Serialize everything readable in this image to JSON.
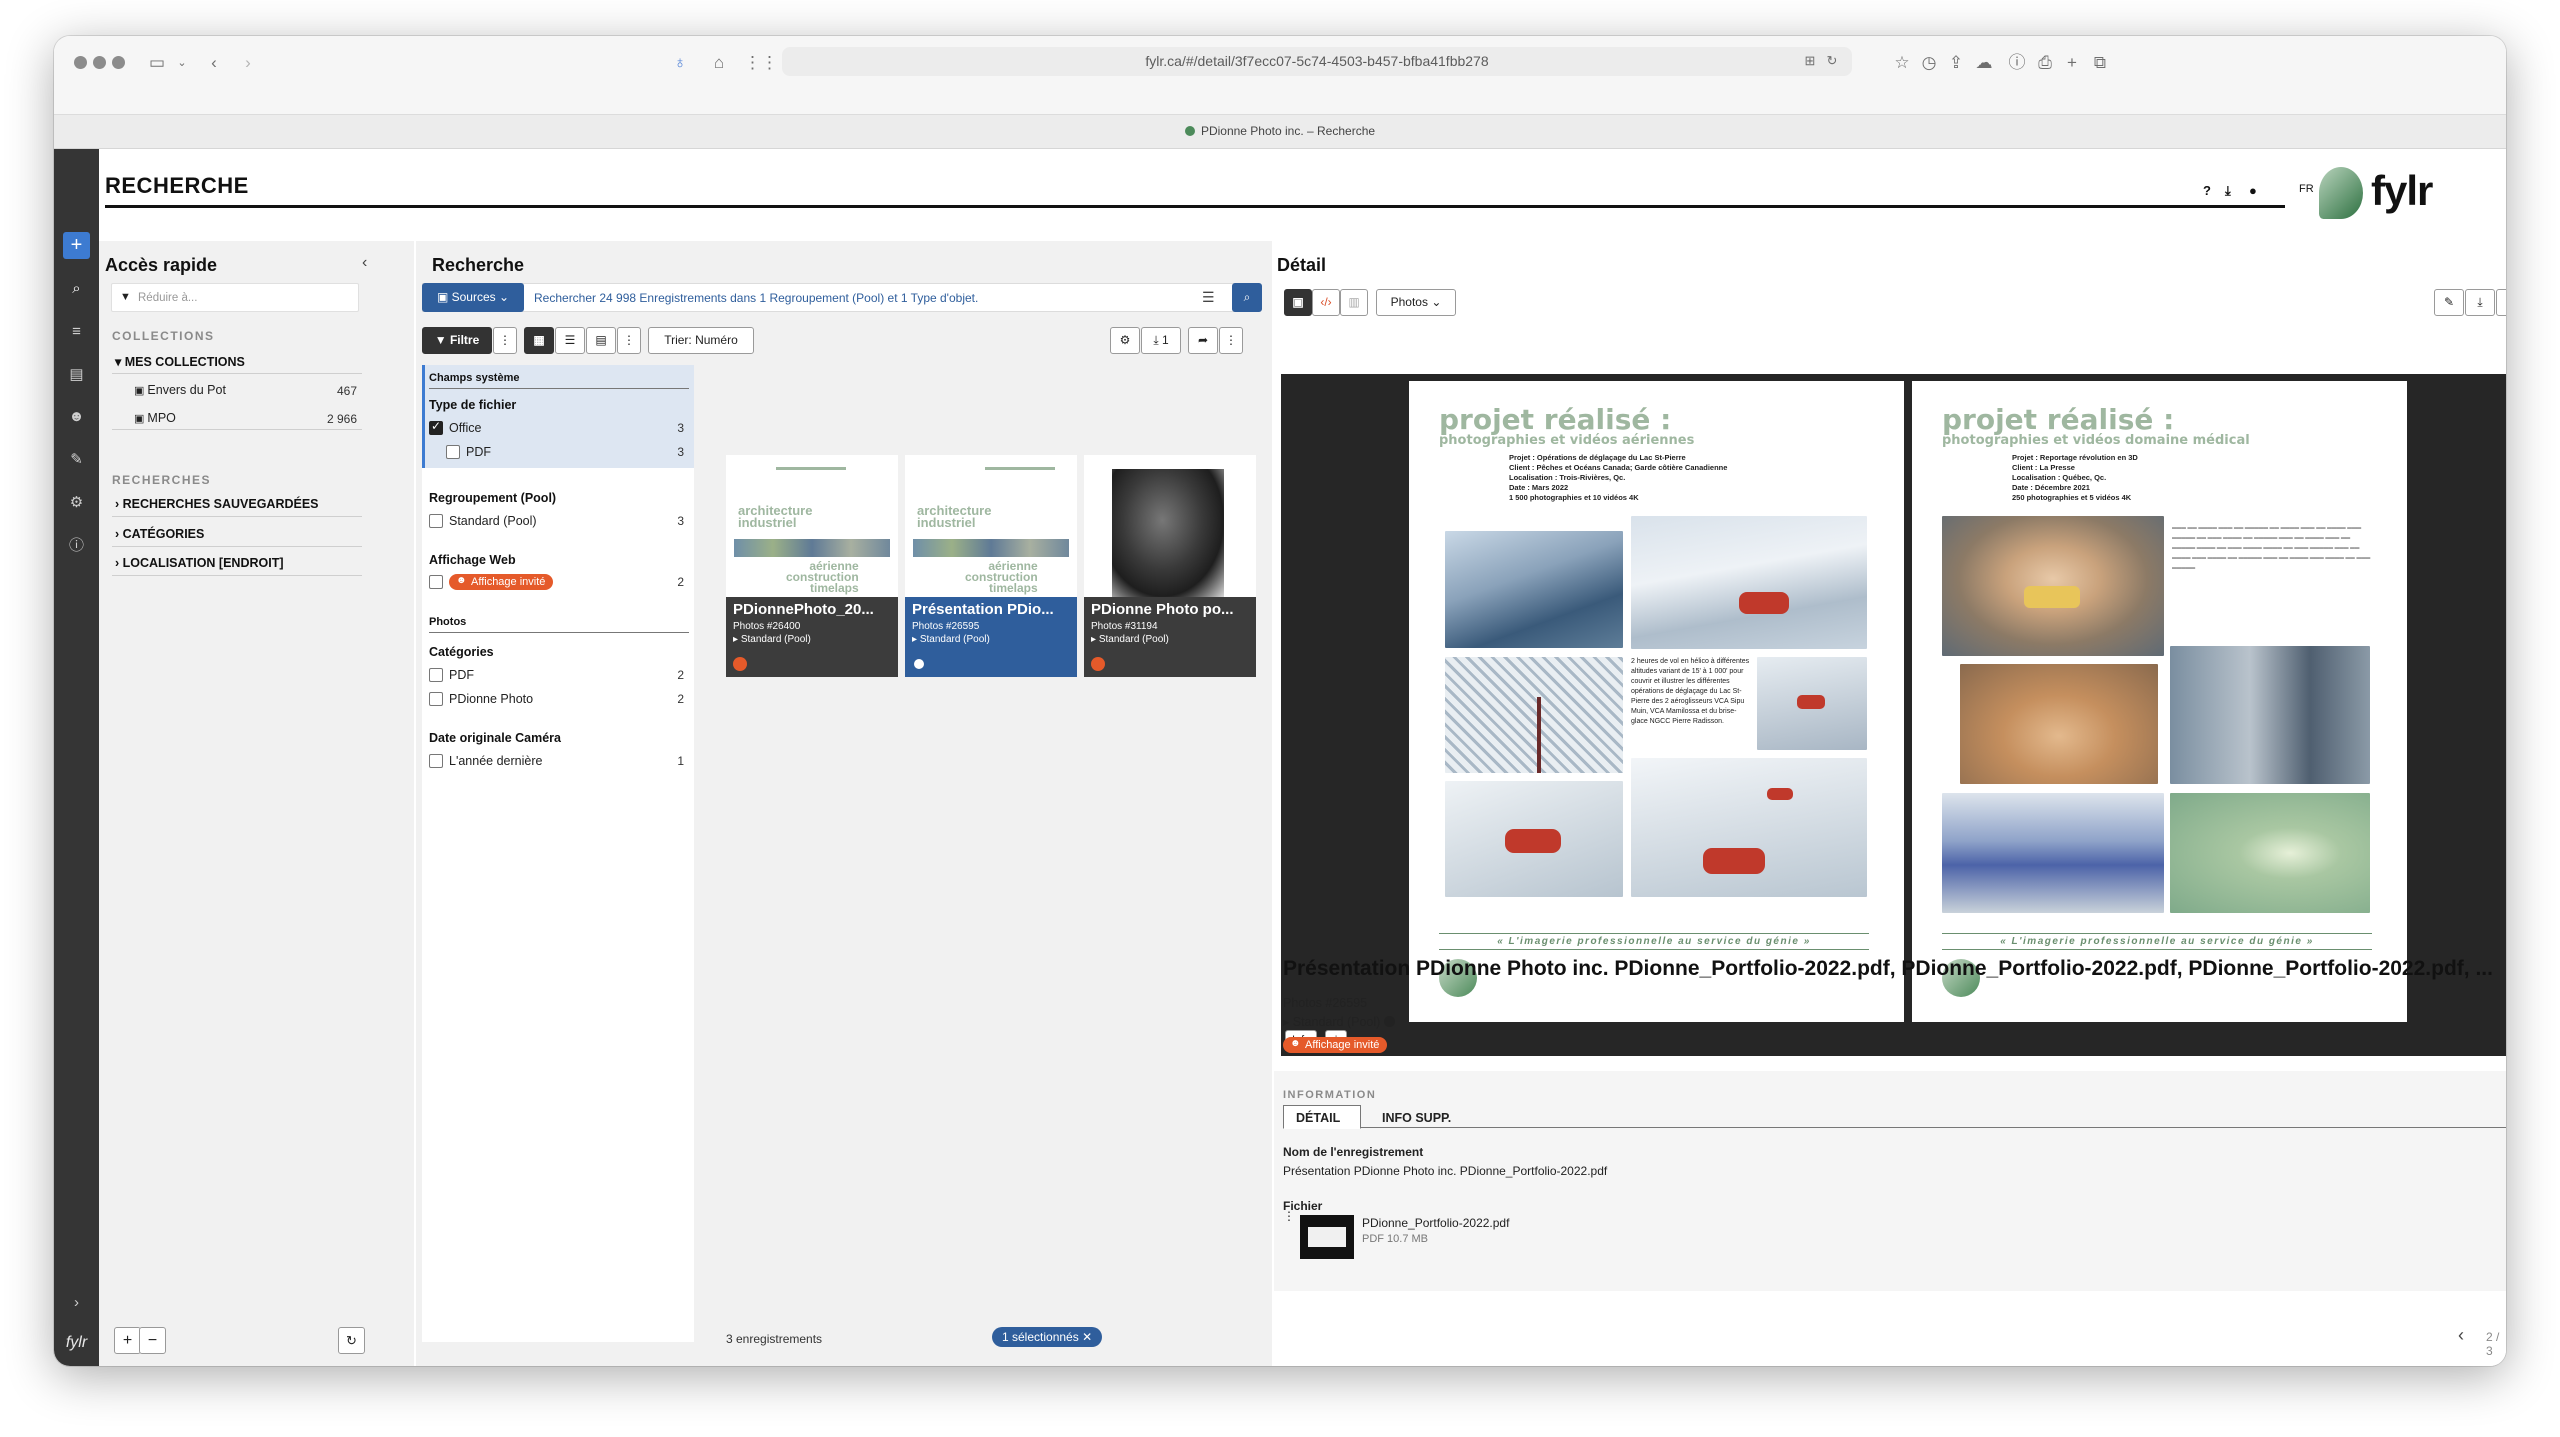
{
  "browser": {
    "url": "fylr.ca/#/detail/3f7ecc07-5c74-4503-b457-bfba41fbb278",
    "tab_title": "PDionne Photo inc. – Recherche"
  },
  "header": {
    "title": "RECHERCHE",
    "lang": "FR",
    "logo_text": "fylr"
  },
  "rail": {
    "bottom_logo": "fylr"
  },
  "quick_access": {
    "title": "Accès rapide",
    "filter_placeholder": "Réduire à...",
    "collections_heading": "COLLECTIONS",
    "my_collections": "MES COLLECTIONS",
    "items": [
      {
        "label": "Envers du Pot",
        "count": "467"
      },
      {
        "label": "MPO",
        "count": "2 966"
      }
    ],
    "searches_heading": "RECHERCHES",
    "search_groups": [
      "RECHERCHES SAUVEGARDÉES",
      "CATÉGORIES",
      "LOCALISATION [ENDROIT]"
    ]
  },
  "search": {
    "title": "Recherche",
    "sources_label": "Sources",
    "search_placeholder": "Rechercher 24 998 Enregistrements dans 1 Regroupement (Pool) et 1 Type d'objet.",
    "filter_label": "Filtre",
    "sort_label": "Trier: Numéro",
    "download_count": "1",
    "facets": {
      "system_fields": "Champs système",
      "file_type": "Type de fichier",
      "file_type_items": [
        {
          "label": "Office",
          "count": "3",
          "checked": true
        },
        {
          "label": "PDF",
          "count": "3",
          "checked": false
        }
      ],
      "pool": "Regroupement (Pool)",
      "pool_items": [
        {
          "label": "Standard (Pool)",
          "count": "3"
        }
      ],
      "web_display": "Affichage Web",
      "web_items": [
        {
          "label": "Affichage invité",
          "count": "2"
        }
      ],
      "photos": "Photos",
      "categories": "Catégories",
      "category_items": [
        {
          "label": "PDF",
          "count": "2"
        },
        {
          "label": "PDionne Photo",
          "count": "2"
        }
      ],
      "camera_date": "Date originale Caméra",
      "camera_items": [
        {
          "label": "L'année dernière",
          "count": "1"
        }
      ]
    },
    "results": [
      {
        "title": "PDionnePhoto_20...",
        "id": "Photos #26400",
        "pool": "Standard (Pool)"
      },
      {
        "title": "Présentation PDio...",
        "id": "Photos #26595",
        "pool": "Standard (Pool)"
      },
      {
        "title": "PDionne Photo po...",
        "id": "Photos #31194",
        "pool": "Standard (Pool)"
      }
    ],
    "result_count": "3 enregistrements",
    "selected_label": "1 sélectionnés"
  },
  "detail": {
    "title": "Détail",
    "mask_label": "Photos",
    "viewer_info": "Info",
    "page_left": {
      "heading": "projet réalisé :",
      "subheading": "photographies et vidéos aériennes",
      "meta": [
        "Projet : Opérations de déglaçage du Lac St-Pierre",
        "Client : Pêches et Océans Canada; Garde côtière Canadienne",
        "Localisation : Trois-Rivières, Qc.",
        "Date : Mars 2022",
        "1 500 photographies et 10 vidéos 4K"
      ],
      "caption": "2 heures de vol en hélico à différentes altitudes variant de 15' à 1 000' pour couvrir et illustrer les différentes opérations de déglaçage du Lac St-Pierre des 2 aéroglisseurs VCA Sipu Muin, VCA Mamilossa et du brise-glace NGCC Pierre Radisson."
    },
    "page_right": {
      "heading": "projet réalisé :",
      "subheading": "photographies et vidéos domaine médical",
      "meta": [
        "Projet : Reportage révolution en 3D",
        "Client : La Presse",
        "Localisation : Québec, Qc.",
        "Date : Décembre 2021",
        "250 photographies et 5 vidéos 4K"
      ]
    },
    "tagline": "« L'imagerie professionnelle au service du génie »",
    "record_title": "Présentation PDionne Photo inc. PDionne_Portfolio-2022.pdf, PDionne_Portfolio-2022.pdf, PDionne_Portfolio-2022.pdf, ...",
    "record_id": "Photos #26595",
    "record_pool": "Standard (Pool)",
    "record_tag": "Affichage invité",
    "info_heading": "INFORMATION",
    "tabs": [
      "DÉTAIL",
      "INFO SUPP."
    ],
    "field_name_label": "Nom de l'enregistrement",
    "field_name_value": "Présentation PDionne Photo inc.  PDionne_Portfolio-2022.pdf",
    "file_label": "Fichier",
    "file_name": "PDionne_Portfolio-2022.pdf",
    "file_size": "PDF 10.7 MB",
    "pager": "2 / 3"
  }
}
